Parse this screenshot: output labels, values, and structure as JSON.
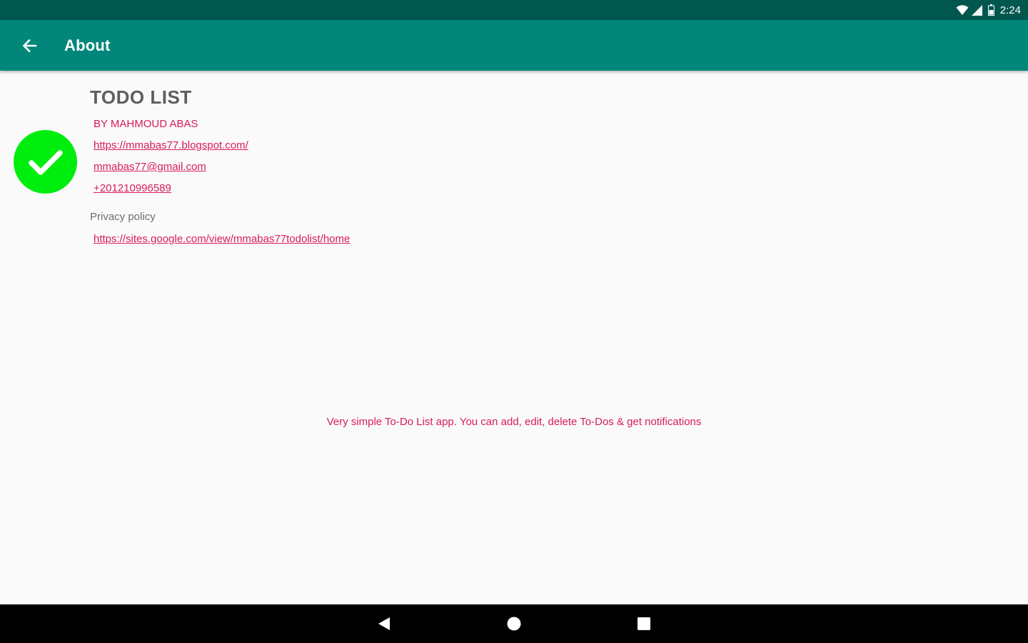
{
  "status_bar": {
    "time": "2:24",
    "icons": [
      "wifi-icon",
      "cell-signal-icon",
      "battery-icon"
    ]
  },
  "app_bar": {
    "back_icon": "arrow-back-icon",
    "title": "About"
  },
  "about": {
    "app_icon": "check-circle-icon",
    "app_name": "TODO LIST",
    "byline": "BY MAHMOUD ABAS",
    "blog_url": "https://mmabas77.blogspot.com/",
    "email": "mmabas77@gmail.com",
    "phone": "+201210996589",
    "privacy_label": "Privacy policy",
    "privacy_url": "https://sites.google.com/view/mmabas77todolist/home",
    "description": "Very simple To-Do List app. You can add, edit, delete To-Dos & get notifications"
  },
  "nav_bar": {
    "buttons": [
      "back-triangle-icon",
      "home-circle-icon",
      "recents-square-icon"
    ]
  },
  "colors": {
    "status_bar": "#00574e",
    "app_bar": "#00877a",
    "accent": "#d81b60",
    "icon_green": "#00ee0e",
    "background": "#fafafa"
  }
}
